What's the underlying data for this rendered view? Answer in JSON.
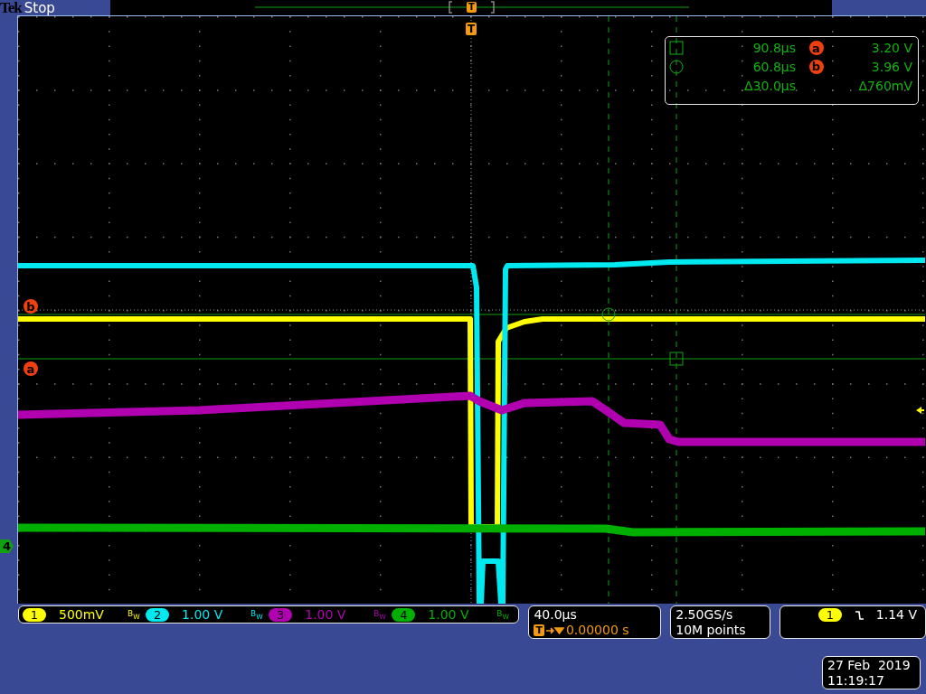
{
  "header": {
    "brand": "Tek",
    "status": "Stop"
  },
  "record_bar": {
    "trigger_label": "T"
  },
  "screen": {
    "trigger_marker": "T",
    "cursor_markers": [
      {
        "label": "b"
      },
      {
        "label": "a"
      }
    ],
    "channel_marker": "4",
    "cursor_readout": [
      {
        "kind": "square",
        "time": "90.8µs",
        "marker": "a",
        "voltage": "3.20 V"
      },
      {
        "kind": "circle",
        "time": "60.8µs",
        "marker": "b",
        "voltage": "3.96 V"
      },
      {
        "kind": "delta",
        "time": "Δ30.0µs",
        "voltage": "Δ760mV"
      }
    ]
  },
  "channels": [
    {
      "number": "1",
      "scale": "500mV",
      "bandwidth": "B$_{W}$",
      "color": "#ffff00"
    },
    {
      "number": "2",
      "scale": "1.00 V",
      "bandwidth": "B$_{W}$",
      "color": "#00e8f0"
    },
    {
      "number": "3",
      "scale": "1.00 V",
      "bandwidth": "B$_{W}$",
      "color": "#b000b0"
    },
    {
      "number": "4",
      "scale": "1.00 V",
      "bandwidth": "B$_{W}$",
      "color": "#00b000"
    }
  ],
  "timebase": {
    "scale": "40.0µs",
    "position_label": "T",
    "position": "0.00000 s"
  },
  "acquisition": {
    "sample_rate": "2.50GS/s",
    "record_length": "10M points"
  },
  "trigger": {
    "channel": "1",
    "color": "#ffff00",
    "level": "1.14 V"
  },
  "clock": {
    "date": "27 Feb  2019",
    "time": "11:19:17"
  }
}
